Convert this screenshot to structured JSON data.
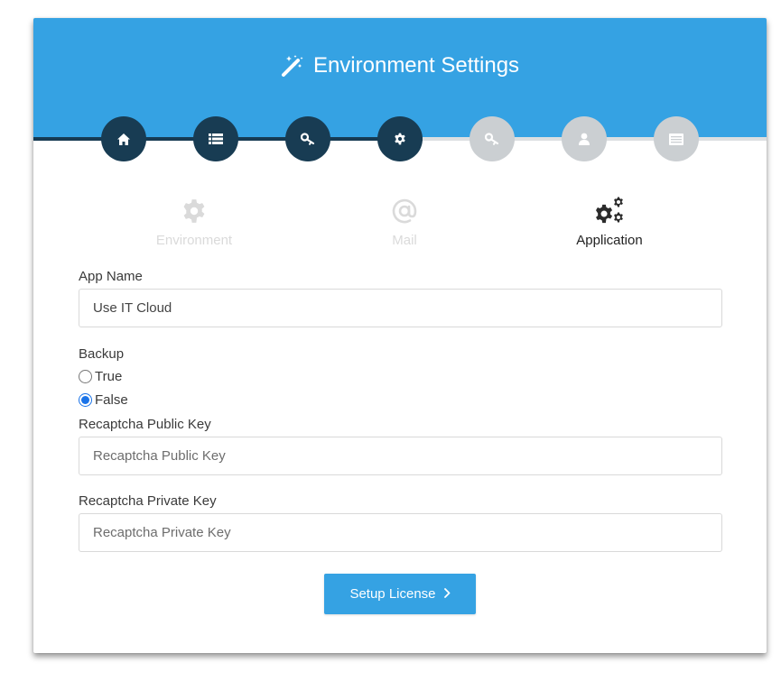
{
  "header": {
    "title": "Environment Settings",
    "title_icon": "magic-wand-icon"
  },
  "steps": [
    {
      "icon": "home-icon",
      "state": "done"
    },
    {
      "icon": "list-icon",
      "state": "done"
    },
    {
      "icon": "key-icon",
      "state": "done"
    },
    {
      "icon": "gear-icon",
      "state": "done"
    },
    {
      "icon": "key-icon",
      "state": "todo"
    },
    {
      "icon": "user-icon",
      "state": "todo"
    },
    {
      "icon": "server-icon",
      "state": "todo"
    }
  ],
  "subtabs": [
    {
      "label": "Environment",
      "icon": "gear-icon",
      "state": "inactive"
    },
    {
      "label": "Mail",
      "icon": "at-sign-icon",
      "state": "inactive"
    },
    {
      "label": "Application",
      "icon": "gears-icon",
      "state": "active"
    }
  ],
  "form": {
    "app_name": {
      "label": "App Name",
      "value": "Use IT Cloud"
    },
    "backup": {
      "label": "Backup",
      "options": [
        {
          "label": "True",
          "checked": false
        },
        {
          "label": "False",
          "checked": true
        }
      ]
    },
    "recaptcha_public": {
      "label": "Recaptcha Public Key",
      "value": "",
      "placeholder": "Recaptcha Public Key"
    },
    "recaptcha_private": {
      "label": "Recaptcha Private Key",
      "value": "",
      "placeholder": "Recaptcha Private Key"
    }
  },
  "submit": {
    "label": "Setup License",
    "icon": "chevron-right-icon"
  },
  "colors": {
    "primary": "#35a2e3",
    "step_done": "#183c53",
    "step_todo": "#cbcfd2"
  }
}
